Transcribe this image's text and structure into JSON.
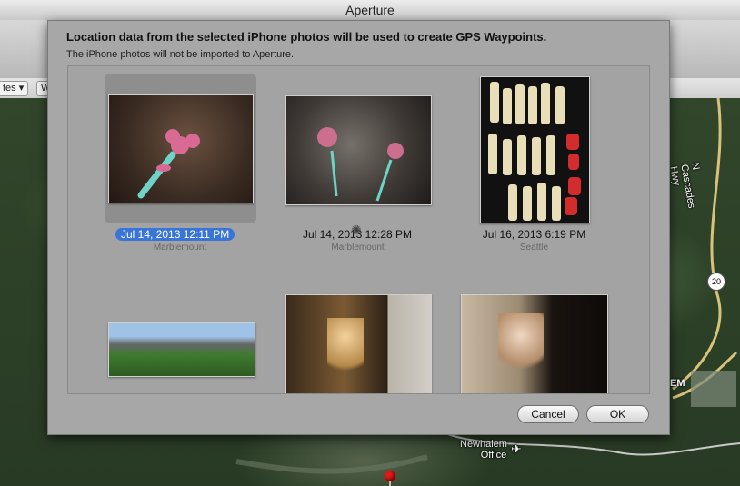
{
  "window": {
    "title": "Aperture"
  },
  "toolbar": {
    "popup_left": "tes",
    "popup_right": "W"
  },
  "sheet": {
    "title": "Location data from the selected iPhone photos will be used to create GPS Waypoints.",
    "subtitle": "The iPhone photos will not be imported to Aperture.",
    "photos": [
      {
        "date": "Jul 14, 2013 12:11 PM",
        "location": "Marblemount",
        "selected": true
      },
      {
        "date": "Jul 14, 2013 12:28 PM",
        "location": "Marblemount",
        "selected": false
      },
      {
        "date": "Jul 16, 2013 6:19 PM",
        "location": "Seattle",
        "selected": false
      }
    ],
    "cancel_label": "Cancel",
    "ok_label": "OK"
  },
  "map": {
    "road_label": "N Cascades Hwy",
    "route_shield": "20",
    "place_label": "Newhalem\nOffice",
    "place_label_line1": "Newhalem",
    "place_label_line2": "Office",
    "partial_label": "EM"
  },
  "colors": {
    "selection": "#3875d7",
    "sheet": "#a7a7a7",
    "pin": "#e01818"
  }
}
